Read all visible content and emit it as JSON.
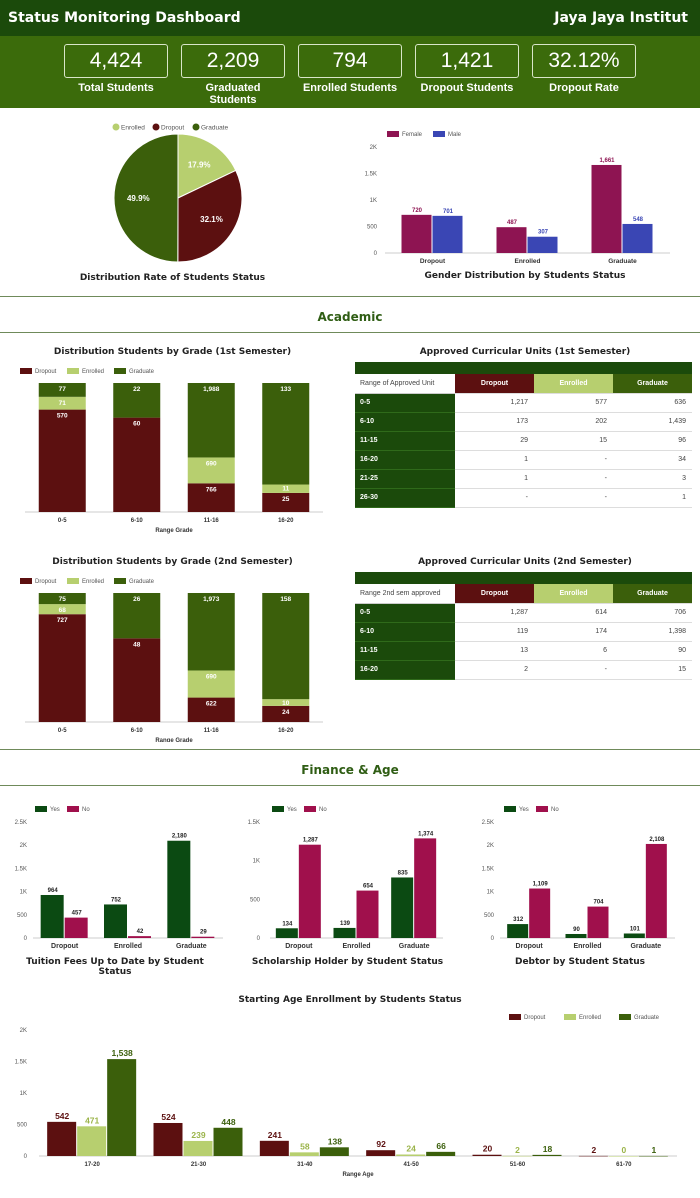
{
  "header": {
    "title": "Status Monitoring Dashboard",
    "org": "Jaya Jaya Institut"
  },
  "kpis": [
    {
      "value": "4,424",
      "label": "Total Students"
    },
    {
      "value": "2,209",
      "label": "Graduated Students"
    },
    {
      "value": "794",
      "label": "Enrolled Students"
    },
    {
      "value": "1,421",
      "label": "Dropout Students"
    },
    {
      "value": "32.12%",
      "label": "Dropout Rate"
    }
  ],
  "colors": {
    "dropout": "#5c1010",
    "enrolled": "#b7cf6f",
    "graduate": "#3b5f0b",
    "female": "#8e1452",
    "male": "#3a46b4",
    "yes": "#0b4a12",
    "no": "#a0104c"
  },
  "sections": {
    "academic": "Academic",
    "finance": "Finance & Age"
  },
  "chart_data": [
    {
      "id": "pie",
      "type": "pie",
      "title": "Distribution Rate of Students Status",
      "legend": [
        "Enrolled",
        "Dropout",
        "Graduate"
      ],
      "slices": [
        {
          "name": "Enrolled",
          "value": 17.9,
          "label": "17.9%"
        },
        {
          "name": "Dropout",
          "value": 32.1,
          "label": "32.1%"
        },
        {
          "name": "Graduate",
          "value": 49.9,
          "label": "49.9%"
        }
      ]
    },
    {
      "id": "gender",
      "type": "bar",
      "title": "Gender Distribution by Students Status",
      "categories": [
        "Dropout",
        "Enrolled",
        "Graduate"
      ],
      "series": [
        {
          "name": "Female",
          "values": [
            720,
            487,
            1661
          ]
        },
        {
          "name": "Male",
          "values": [
            701,
            307,
            548
          ]
        }
      ],
      "ylim": [
        0,
        2000
      ],
      "yticks": [
        "0",
        "500",
        "1K",
        "1.5K",
        "2K"
      ]
    },
    {
      "id": "grade1",
      "type": "bar",
      "stacked": true,
      "title": "Distribution Students by Grade (1st Semester)",
      "xlabel": "Range Grade",
      "categories": [
        "0-5",
        "6-10",
        "11-16",
        "16-20"
      ],
      "series": [
        {
          "name": "Dropout",
          "values": [
            570,
            60,
            766,
            25
          ],
          "labels": [
            "570",
            "60",
            "766",
            "25"
          ]
        },
        {
          "name": "Enrolled",
          "values": [
            71,
            0,
            690,
            11
          ],
          "labels": [
            "71",
            "",
            "690",
            "11"
          ]
        },
        {
          "name": "Graduate",
          "values": [
            77,
            22,
            1988,
            133
          ],
          "labels": [
            "77",
            "22",
            "1,988",
            "133"
          ]
        }
      ]
    },
    {
      "id": "grade2",
      "type": "bar",
      "stacked": true,
      "title": "Distribution Students by Grade (2nd Semester)",
      "xlabel": "Range Grade",
      "categories": [
        "0-5",
        "6-10",
        "11-16",
        "16-20"
      ],
      "series": [
        {
          "name": "Dropout",
          "values": [
            727,
            48,
            622,
            24
          ],
          "labels": [
            "727",
            "48",
            "622",
            "24"
          ]
        },
        {
          "name": "Enrolled",
          "values": [
            68,
            0,
            690,
            10
          ],
          "labels": [
            "68",
            "",
            "690",
            "10"
          ]
        },
        {
          "name": "Graduate",
          "values": [
            75,
            26,
            1973,
            158
          ],
          "labels": [
            "75",
            "26",
            "1,973",
            "158"
          ]
        }
      ]
    },
    {
      "id": "tuition",
      "type": "bar",
      "title": "Tuition Fees Up to Date by Student Status",
      "categories": [
        "Dropout",
        "Enrolled",
        "Graduate"
      ],
      "series": [
        {
          "name": "Yes",
          "values": [
            964,
            752,
            2180
          ]
        },
        {
          "name": "No",
          "values": [
            457,
            42,
            29
          ]
        }
      ],
      "ylim": [
        0,
        2600
      ],
      "yticks": [
        "0",
        "500",
        "1K",
        "1.5K",
        "2K",
        "2.5K"
      ]
    },
    {
      "id": "scholar",
      "type": "bar",
      "title": "Scholarship Holder by Student Status",
      "categories": [
        "Dropout",
        "Enrolled",
        "Graduate"
      ],
      "series": [
        {
          "name": "Yes",
          "values": [
            134,
            139,
            835
          ]
        },
        {
          "name": "No",
          "values": [
            1287,
            654,
            1374
          ]
        }
      ],
      "ylim": [
        0,
        1600
      ],
      "yticks": [
        "0",
        "500",
        "1K",
        "1.5K"
      ]
    },
    {
      "id": "debtor",
      "type": "bar",
      "title": "Debtor by Student Status",
      "categories": [
        "Dropout",
        "Enrolled",
        "Graduate"
      ],
      "series": [
        {
          "name": "Yes",
          "values": [
            312,
            90,
            101
          ]
        },
        {
          "name": "No",
          "values": [
            1109,
            704,
            2108
          ]
        }
      ],
      "ylim": [
        0,
        2600
      ],
      "yticks": [
        "0",
        "500",
        "1K",
        "1.5K",
        "2K",
        "2.5K"
      ]
    },
    {
      "id": "age",
      "type": "bar",
      "title": "Starting Age Enrollment by Students Status",
      "xlabel": "Range Age",
      "categories": [
        "17-20",
        "21-30",
        "31-40",
        "41-50",
        "51-60",
        "61-70"
      ],
      "series": [
        {
          "name": "Dropout",
          "values": [
            542,
            524,
            241,
            92,
            20,
            2
          ]
        },
        {
          "name": "Enrolled",
          "values": [
            471,
            239,
            58,
            24,
            2,
            0
          ]
        },
        {
          "name": "Graduate",
          "values": [
            1538,
            448,
            138,
            66,
            18,
            1
          ]
        }
      ],
      "ylim": [
        0,
        2000
      ],
      "yticks": [
        "0",
        "500",
        "1K",
        "1.5K",
        "2K"
      ]
    }
  ],
  "tables": {
    "cu1": {
      "title": "Approved Curricular Units (1st Semester)",
      "headers": [
        "Range of Approved Unit",
        "Dropout",
        "Enrolled",
        "Graduate"
      ],
      "rows": [
        [
          "0-5",
          "1,217",
          "577",
          "636"
        ],
        [
          "6-10",
          "173",
          "202",
          "1,439"
        ],
        [
          "11-15",
          "29",
          "15",
          "96"
        ],
        [
          "16-20",
          "1",
          "-",
          "34"
        ],
        [
          "21-25",
          "1",
          "-",
          "3"
        ],
        [
          "26-30",
          "-",
          "-",
          "1"
        ]
      ]
    },
    "cu2": {
      "title": "Approved Curricular Units (2nd Semester)",
      "headers": [
        "Range 2nd sem approved",
        "Dropout",
        "Enrolled",
        "Graduate"
      ],
      "rows": [
        [
          "0-5",
          "1,287",
          "614",
          "706"
        ],
        [
          "6-10",
          "119",
          "174",
          "1,398"
        ],
        [
          "11-15",
          "13",
          "6",
          "90"
        ],
        [
          "16-20",
          "2",
          "-",
          "15"
        ]
      ]
    }
  }
}
